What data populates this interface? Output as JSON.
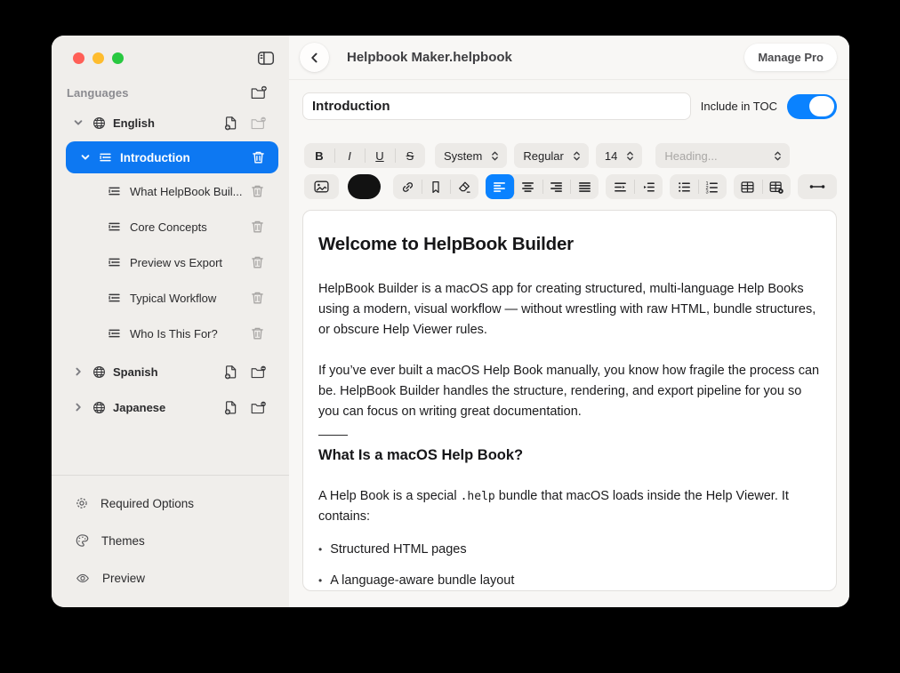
{
  "window": {
    "doc_title": "Helpbook Maker.helpbook",
    "manage_pro_label": "Manage Pro"
  },
  "sidebar": {
    "section_title": "Languages",
    "tree": [
      {
        "label": "English",
        "type": "language",
        "expanded": true
      },
      {
        "label": "Introduction",
        "type": "page",
        "selected": true,
        "expanded": true
      },
      {
        "label": "What HelpBook Buil...",
        "type": "subpage"
      },
      {
        "label": "Core Concepts",
        "type": "subpage"
      },
      {
        "label": "Preview vs Export",
        "type": "subpage"
      },
      {
        "label": "Typical Workflow",
        "type": "subpage"
      },
      {
        "label": "Who Is This For?",
        "type": "subpage"
      },
      {
        "label": "Spanish",
        "type": "language",
        "expanded": false
      },
      {
        "label": "Japanese",
        "type": "language",
        "expanded": false
      }
    ],
    "footer": [
      {
        "label": "Required Options",
        "icon": "gear-icon"
      },
      {
        "label": "Themes",
        "icon": "palette-icon"
      },
      {
        "label": "Preview",
        "icon": "eye-icon"
      }
    ]
  },
  "editor_meta": {
    "title_value": "Introduction",
    "toc_label": "Include in TOC",
    "toc_enabled": true
  },
  "toolbar": {
    "format": [
      "B",
      "I",
      "U",
      "S"
    ],
    "font_family": "System",
    "font_weight": "Regular",
    "font_size": "14",
    "heading_placeholder": "Heading...",
    "active_alignment": "left",
    "icons": [
      "image-icon",
      "text-color-swatch",
      "link-icon",
      "bookmark-icon",
      "eraser-icon",
      "align-left-icon",
      "align-center-icon",
      "align-right-icon",
      "align-justify-icon",
      "outdent-icon",
      "indent-icon",
      "bullet-list-icon",
      "numbered-list-icon",
      "table-icon",
      "table-options-icon",
      "horizontal-rule-icon"
    ]
  },
  "document": {
    "h1": "Welcome to HelpBook Builder",
    "p1": "HelpBook Builder is a macOS app for creating structured, multi-language Help Books using a modern, visual workflow — without wrestling with raw HTML, bundle structures, or obscure Help Viewer rules.",
    "p2": "If you’ve ever built a macOS Help Book manually, you know how fragile the process can be. HelpBook Builder handles the structure, rendering, and export pipeline for you so you can focus on writing great documentation.",
    "h2": "What Is a macOS Help Book?",
    "p3_pre": "A Help Book is a special ",
    "p3_code": ".help",
    "p3_post": " bundle that macOS loads inside the Help Viewer. It contains:",
    "bullets": [
      "Structured HTML pages",
      "A language-aware bundle layout"
    ]
  },
  "colors": {
    "accent_blue": "#0a82ff",
    "selection_blue": "#0d78f2",
    "sidebar_bg": "#f0eeeb",
    "main_bg": "#f8f7f5",
    "traffic_red": "#ff5f57",
    "traffic_yellow": "#febc2e",
    "traffic_green": "#28c840"
  }
}
